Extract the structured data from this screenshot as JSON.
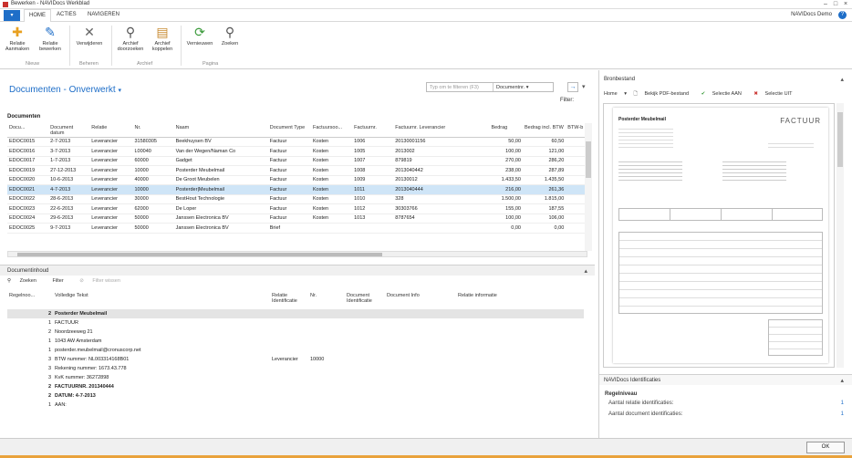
{
  "window": {
    "title": "Bewerken - NAVIDocs Werkblad",
    "user": "NAVIDocs Demo"
  },
  "tabs": [
    {
      "label": "HOME"
    },
    {
      "label": "ACTIES"
    },
    {
      "label": "NAVIGEREN"
    }
  ],
  "ribbon": {
    "buttons": [
      {
        "label": "Relatie Aanmaken",
        "icon": "add-relation-icon"
      },
      {
        "label": "Relatie bewerken",
        "icon": "edit-pencil-icon"
      },
      {
        "label": "Verwijderen",
        "icon": "delete-x-icon"
      },
      {
        "label": "Archief doorzoeken",
        "icon": "binoculars-icon"
      },
      {
        "label": "Archief koppelen",
        "icon": "archive-link-icon"
      },
      {
        "label": "Vernieuwen",
        "icon": "refresh-icon"
      },
      {
        "label": "Zoeken",
        "icon": "binoculars-icon"
      }
    ],
    "groups": [
      "Nieuw",
      "Beheren",
      "Archief",
      "Pagina"
    ]
  },
  "page": {
    "title": "Documenten - Onverwerkt",
    "filter_placeholder": "Typ om te filteren (F3)",
    "filter_field": "Documentnr.",
    "filter_label": "Filter:"
  },
  "documents": {
    "section": "Documenten",
    "columns": [
      "Docu...",
      "Document datum",
      "Relatie",
      "Nr.",
      "Naam",
      "Document Type",
      "Factuursoo...",
      "Factuurnr.",
      "Factuurnr. Leverancier",
      "Bedrag",
      "Bedrag incl. BTW",
      "BTW-b"
    ],
    "rows": [
      [
        "EDOC0015",
        "2-7-2013",
        "Leverancier",
        "31580305",
        "Beekhuysen BV",
        "Factuur",
        "Kosten",
        "1006",
        "20130001156",
        "50,00",
        "60,50"
      ],
      [
        "EDOC0016",
        "3-7-2013",
        "Leverancier",
        "L00040",
        "Van der Wegen/Naman Co",
        "Factuur",
        "Kosten",
        "1005",
        "2013002",
        "100,00",
        "121,00"
      ],
      [
        "EDOC0017",
        "1-7-2013",
        "Leverancier",
        "60000",
        "Gadget",
        "Factuur",
        "Kosten",
        "1007",
        "879819",
        "270,00",
        "286,20"
      ],
      [
        "EDOC0019",
        "27-12-2013",
        "Leverancier",
        "10000",
        "Posterder Meubelmail",
        "Factuur",
        "Kosten",
        "1008",
        "2013040442",
        "238,00",
        "287,89"
      ],
      [
        "EDOC0020",
        "10-6-2013",
        "Leverancier",
        "40000",
        "De Groot Meubelen",
        "Factuur",
        "Kosten",
        "1009",
        "20130012",
        "1.433,50",
        "1.435,50"
      ],
      [
        "EDOC0021",
        "4-7-2013",
        "Leverancier",
        "10000",
        "Posterder|Meubelmail",
        "Factuur",
        "Kosten",
        "1011",
        "2013040444",
        "216,00",
        "261,36"
      ],
      [
        "EDOC0022",
        "28-6-2013",
        "Leverancier",
        "30000",
        "BestHout Technologie",
        "Factuur",
        "Kosten",
        "1010",
        "328",
        "1.500,00",
        "1.815,00"
      ],
      [
        "EDOC0023",
        "22-6-2013",
        "Leverancier",
        "62000",
        "De Loper",
        "Factuur",
        "Kosten",
        "1012",
        "30303766",
        "155,00",
        "187,55"
      ],
      [
        "EDOC0024",
        "29-6-2013",
        "Leverancier",
        "50000",
        "Janssen Electronica BV",
        "Factuur",
        "Kosten",
        "1013",
        "8787654",
        "100,00",
        "106,00"
      ],
      [
        "EDOC0025",
        "9-7-2013",
        "Leverancier",
        "50000",
        "Janssen Electronica BV",
        "Brief",
        "",
        "",
        "",
        "0,00",
        "0,00"
      ]
    ],
    "selected_index": 5
  },
  "content": {
    "section": "Documentinhoud",
    "toolbar": [
      "Zoeken",
      "Filter",
      "Filter wissen"
    ],
    "columns": [
      "Regelnoo...",
      "Volledige Tekst",
      "Relatie Identificatie",
      "Nr.",
      "Document Identificatie",
      "Document Info",
      "Relatie informatie"
    ],
    "rows": [
      {
        "n": "2",
        "text": "Posterder Meubelmail",
        "rel": "",
        "nr": "",
        "bold": true,
        "sel": true
      },
      {
        "n": "1",
        "text": "FACTUUR",
        "rel": "",
        "nr": "",
        "bold": false
      },
      {
        "n": "2",
        "text": "Noordzeeweg 21",
        "rel": "",
        "nr": "",
        "bold": false
      },
      {
        "n": "1",
        "text": "1043 AW Amsterdam",
        "rel": "",
        "nr": "",
        "bold": false
      },
      {
        "n": "1",
        "text": "posterder.meubelmail@cronuscorp.net",
        "rel": "",
        "nr": "",
        "bold": false
      },
      {
        "n": "3",
        "text": "BTW nummer: NL003314168B01",
        "rel": "Leverancier",
        "nr": "10000",
        "bold": false
      },
      {
        "n": "3",
        "text": "Rekening nummer: 1673.43.778",
        "rel": "",
        "nr": "",
        "bold": false
      },
      {
        "n": "3",
        "text": "KvK nummer: 36272898",
        "rel": "",
        "nr": "",
        "bold": false
      },
      {
        "n": "2",
        "text": "FACTUURNR. 201340444",
        "rel": "",
        "nr": "",
        "bold": true
      },
      {
        "n": "2",
        "text": "DATUM: 4-7-2013",
        "rel": "",
        "nr": "",
        "bold": true
      },
      {
        "n": "1",
        "text": "AAN:",
        "rel": "",
        "nr": "",
        "bold": false
      }
    ]
  },
  "bron": {
    "title": "Bronbestand",
    "toolbar": [
      "Home",
      "Bekijk PDF-bestand",
      "Selectie AAN",
      "Selectie UIT"
    ],
    "doc_company": "Posterder Meubelmail",
    "doc_title": "FACTUUR"
  },
  "ident": {
    "title": "NAVIDocs Identificaties",
    "sub": "Regelniveau",
    "rows": [
      {
        "label": "Aantal relatie identificaties:",
        "value": "1"
      },
      {
        "label": "Aantal document identificaties:",
        "value": "1"
      }
    ]
  },
  "footer": {
    "ok": "OK"
  },
  "colors": {
    "accent": "#1e6ec8",
    "selected_row": "#cfe5f7"
  }
}
